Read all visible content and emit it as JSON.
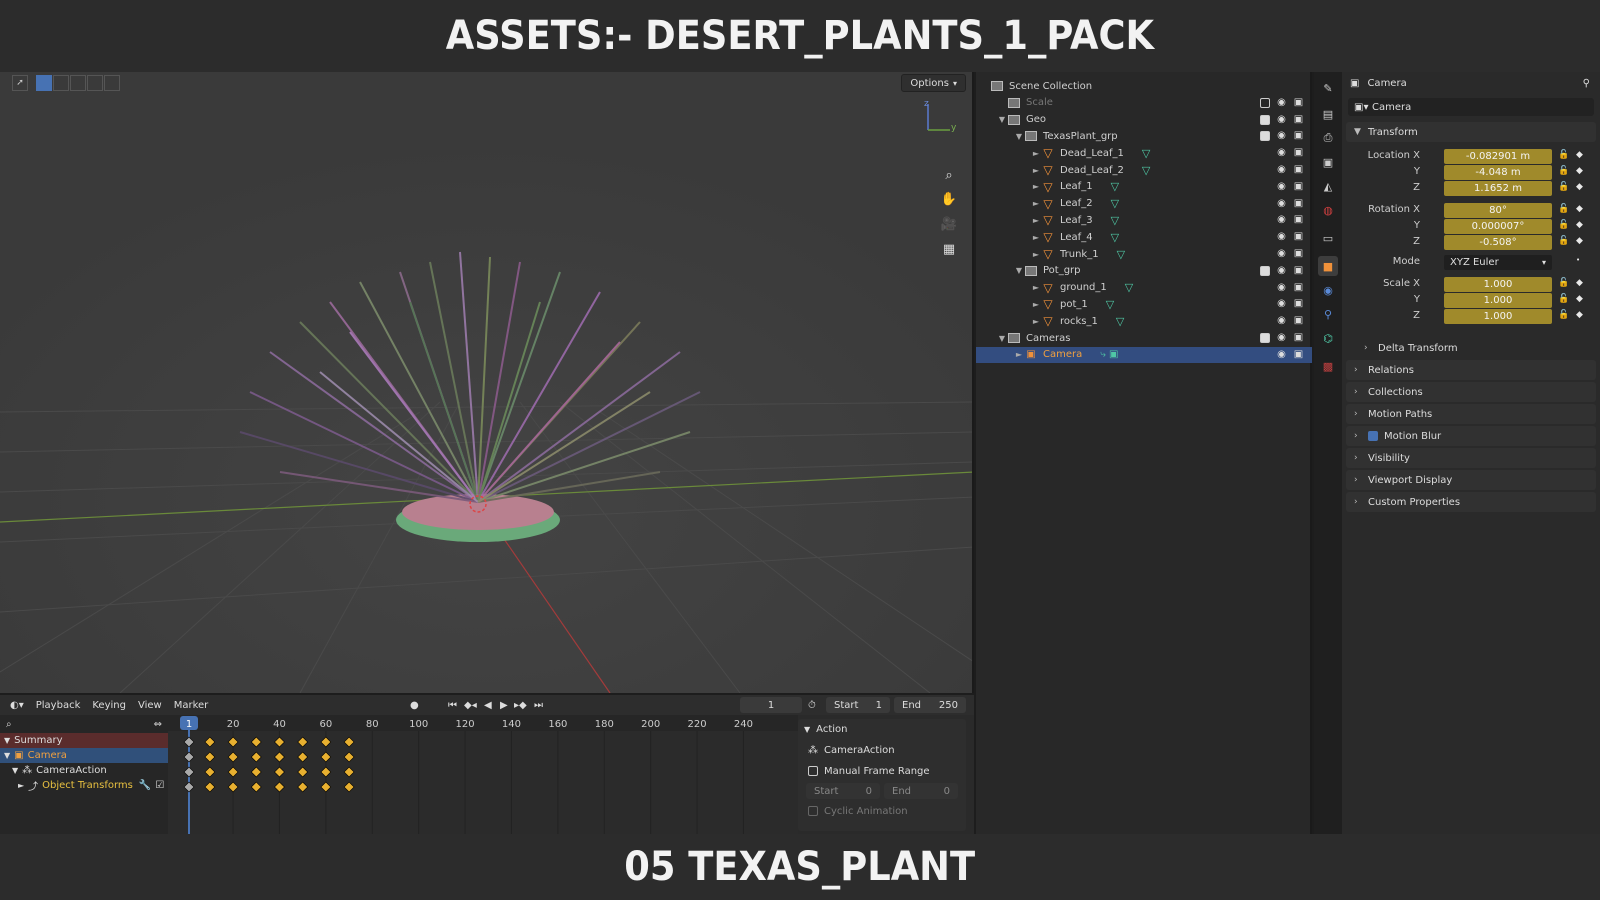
{
  "banner": {
    "top_title": "ASSETS:- DESERT_PLANTS_1_PACK",
    "bottom_title": "05 TEXAS_PLANT"
  },
  "viewport": {
    "options_label": "Options",
    "axis_labels": {
      "z": "z",
      "y": "y"
    }
  },
  "outliner": {
    "rows": [
      {
        "label": "Scene Collection",
        "level": 0,
        "type": "scene",
        "arrow": ""
      },
      {
        "label": "Scale",
        "level": 1,
        "type": "collection",
        "arrow": "",
        "dim": true
      },
      {
        "label": "Geo",
        "level": 1,
        "type": "collection",
        "arrow": "▼"
      },
      {
        "label": "TexasPlant_grp",
        "level": 2,
        "type": "collection",
        "arrow": "▼"
      },
      {
        "label": "Dead_Leaf_1",
        "level": 3,
        "type": "mesh",
        "arrow": "►"
      },
      {
        "label": "Dead_Leaf_2",
        "level": 3,
        "type": "mesh",
        "arrow": "►"
      },
      {
        "label": "Leaf_1",
        "level": 3,
        "type": "mesh",
        "arrow": "►"
      },
      {
        "label": "Leaf_2",
        "level": 3,
        "type": "mesh",
        "arrow": "►"
      },
      {
        "label": "Leaf_3",
        "level": 3,
        "type": "mesh",
        "arrow": "►"
      },
      {
        "label": "Leaf_4",
        "level": 3,
        "type": "mesh",
        "arrow": "►"
      },
      {
        "label": "Trunk_1",
        "level": 3,
        "type": "mesh",
        "arrow": "►"
      },
      {
        "label": "Pot_grp",
        "level": 2,
        "type": "collection",
        "arrow": "▼"
      },
      {
        "label": "ground_1",
        "level": 3,
        "type": "mesh",
        "arrow": "►"
      },
      {
        "label": "pot_1",
        "level": 3,
        "type": "mesh",
        "arrow": "►"
      },
      {
        "label": "rocks_1",
        "level": 3,
        "type": "mesh",
        "arrow": "►"
      },
      {
        "label": "Cameras",
        "level": 1,
        "type": "collection",
        "arrow": "▼"
      },
      {
        "label": "Camera",
        "level": 2,
        "type": "camera",
        "arrow": "►",
        "selected": true
      }
    ]
  },
  "properties": {
    "header": "Camera",
    "object_name": "Camera",
    "transform_label": "Transform",
    "location": {
      "label": "Location X",
      "x": "-0.082901 m",
      "y": "-4.048 m",
      "z": "1.1652 m"
    },
    "rotation": {
      "label": "Rotation X",
      "x": "80°",
      "y": "0.000007°",
      "z": "-0.508°"
    },
    "mode": {
      "label": "Mode",
      "value": "XYZ Euler"
    },
    "scale": {
      "label": "Scale X",
      "x": "1.000",
      "y": "1.000",
      "z": "1.000"
    },
    "axis_y": "Y",
    "axis_z": "Z",
    "delta_transform": "Delta Transform",
    "panels": [
      "Relations",
      "Collections",
      "Motion Paths",
      "Motion Blur",
      "Visibility",
      "Viewport Display",
      "Custom Properties"
    ]
  },
  "timeline": {
    "menus": [
      "Playback",
      "Keying",
      "View",
      "Marker"
    ],
    "current_frame": "1",
    "start_label": "Start",
    "start_value": "1",
    "end_label": "End",
    "end_value": "250",
    "ruler": [
      "1",
      "20",
      "40",
      "60",
      "80",
      "100",
      "120",
      "140",
      "160",
      "180",
      "200",
      "220",
      "240"
    ],
    "channels": [
      "Summary",
      "Camera",
      "CameraAction",
      "Object Transforms"
    ],
    "keyframes": [
      1,
      10,
      20,
      30,
      40,
      50,
      60,
      70
    ]
  },
  "action_panel": {
    "title": "Action",
    "action_name": "CameraAction",
    "manual_range": "Manual Frame Range",
    "start_label": "Start",
    "start_value": "0",
    "end_label": "End",
    "end_value": "0",
    "cyclic": "Cyclic Animation"
  }
}
